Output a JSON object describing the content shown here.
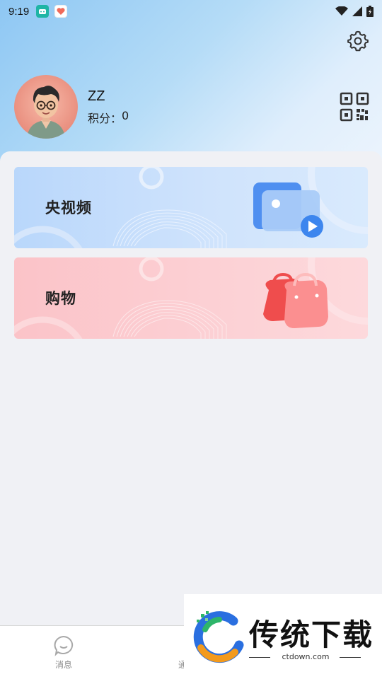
{
  "status_bar": {
    "time": "9:19"
  },
  "profile": {
    "name": "ZZ",
    "points_label": "积分：",
    "points_value": "0"
  },
  "cards": [
    {
      "label": "央视频",
      "icon": "video-icon"
    },
    {
      "label": "购物",
      "icon": "shopping-bag-icon"
    }
  ],
  "bottom_nav": {
    "items": [
      {
        "label": "消息",
        "icon": "message-icon"
      },
      {
        "label": "通",
        "icon": "contacts-icon"
      }
    ]
  },
  "watermark": {
    "text": "传统下载",
    "url": "ctdown.com"
  },
  "colors": {
    "header_gradient_start": "#8ec7f3",
    "video_card": "#b9d7fb",
    "shop_card": "#fbc3c8",
    "shop_accent": "#f15a5a",
    "video_accent": "#4a90f0"
  }
}
